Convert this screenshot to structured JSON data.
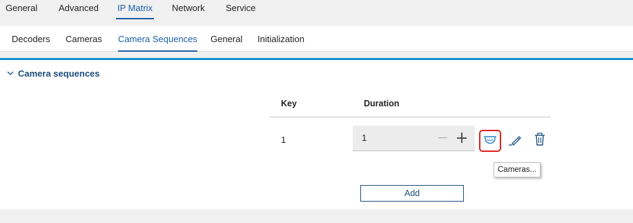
{
  "top_tabs": [
    {
      "label": "General"
    },
    {
      "label": "Advanced"
    },
    {
      "label": "IP Matrix",
      "active": true
    },
    {
      "label": "Network"
    },
    {
      "label": "Service"
    }
  ],
  "sub_tabs": [
    {
      "label": "Decoders"
    },
    {
      "label": "Cameras"
    },
    {
      "label": "Camera Sequences",
      "active": true
    },
    {
      "label": "General"
    },
    {
      "label": "Initialization"
    }
  ],
  "section": {
    "title": "Camera sequences",
    "expanded": true
  },
  "table": {
    "headers": {
      "key": "Key",
      "duration": "Duration"
    },
    "rows": [
      {
        "key": "1",
        "duration": "1"
      }
    ]
  },
  "row_actions": {
    "cameras_icon": "camera-dome-icon",
    "edit_icon": "pencil-icon",
    "delete_icon": "trash-icon"
  },
  "tooltip": "Cameras...",
  "add_button": "Add",
  "colors": {
    "accent": "#1a5fa8",
    "panel_top_border": "#0f8fd0",
    "highlight_border": "#e0201a"
  }
}
